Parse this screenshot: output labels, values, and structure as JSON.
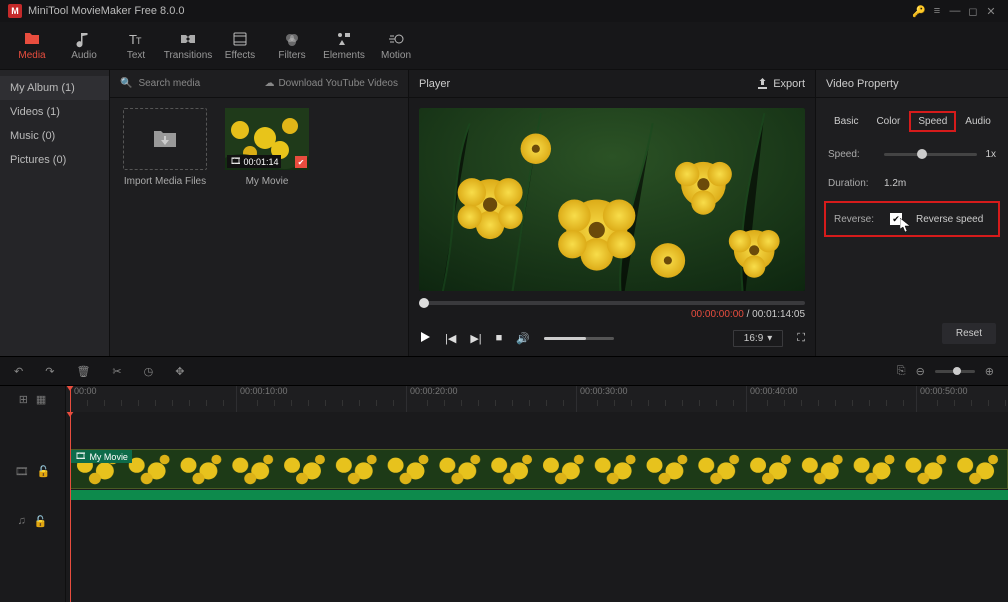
{
  "titlebar": {
    "title": "MiniTool MovieMaker Free 8.0.0"
  },
  "ribbon": [
    {
      "label": "Media",
      "icon": "media-icon",
      "active": true
    },
    {
      "label": "Audio",
      "icon": "audio-icon",
      "active": false
    },
    {
      "label": "Text",
      "icon": "text-icon",
      "active": false
    },
    {
      "label": "Transitions",
      "icon": "transitions-icon",
      "active": false
    },
    {
      "label": "Effects",
      "icon": "effects-icon",
      "active": false
    },
    {
      "label": "Filters",
      "icon": "filters-icon",
      "active": false
    },
    {
      "label": "Elements",
      "icon": "elements-icon",
      "active": false
    },
    {
      "label": "Motion",
      "icon": "motion-icon",
      "active": false
    }
  ],
  "media": {
    "sidebar": [
      {
        "label": "My Album (1)",
        "header": true
      },
      {
        "label": "Videos (1)"
      },
      {
        "label": "Music (0)"
      },
      {
        "label": "Pictures (0)"
      }
    ],
    "search_placeholder": "Search media",
    "download_label": "Download YouTube Videos",
    "import_label": "Import Media Files",
    "clip": {
      "name": "My Movie",
      "duration": "00:01:14"
    }
  },
  "player": {
    "title": "Player",
    "export_label": "Export",
    "time_current": "00:00:00:00",
    "time_total": "00:01:14:05",
    "aspect": "16:9"
  },
  "property": {
    "title": "Video Property",
    "tabs": [
      "Basic",
      "Color",
      "Speed",
      "Audio"
    ],
    "active_tab_index": 2,
    "speed_label": "Speed:",
    "speed_value": "1x",
    "duration_label": "Duration:",
    "duration_value": "1.2m",
    "reverse_label": "Reverse:",
    "reverse_checkbox_label": "Reverse speed",
    "reverse_checked": true,
    "reset_label": "Reset"
  },
  "timeline": {
    "ruler": [
      "00:00",
      "00:00:10:00",
      "00:00:20:00",
      "00:00:30:00",
      "00:00:40:00",
      "00:00:50:00"
    ],
    "clip_name": "My Movie"
  }
}
